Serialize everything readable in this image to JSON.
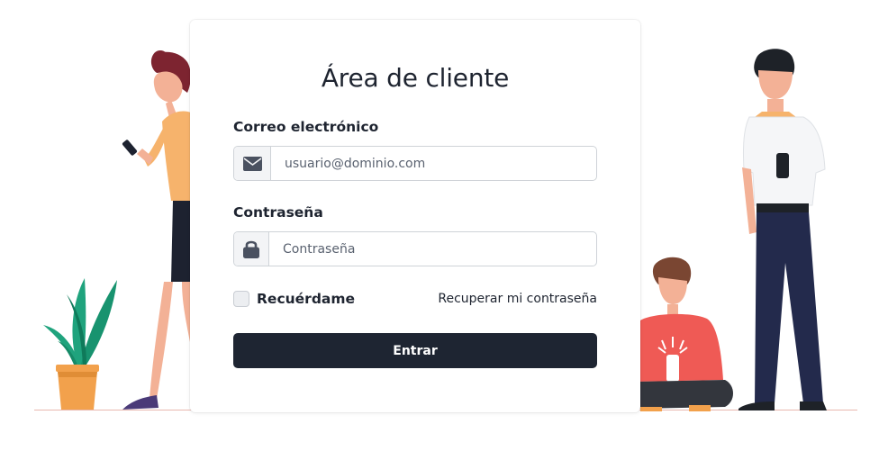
{
  "login": {
    "title": "Área de cliente",
    "email_label": "Correo electrónico",
    "email_placeholder": "usuario@dominio.com",
    "password_label": "Contraseña",
    "password_placeholder": "Contraseña",
    "remember_label": "Recuérdame",
    "recover_link": "Recuperar mi contraseña",
    "submit_label": "Entrar"
  },
  "icons": {
    "email": "envelope-icon",
    "password": "lock-icon"
  },
  "colors": {
    "primary_button": "#1e2532",
    "text": "#1e2430",
    "plant_leaf": "#1fa37d",
    "pot": "#f2a14c",
    "shirt_red": "#ef5a55"
  }
}
